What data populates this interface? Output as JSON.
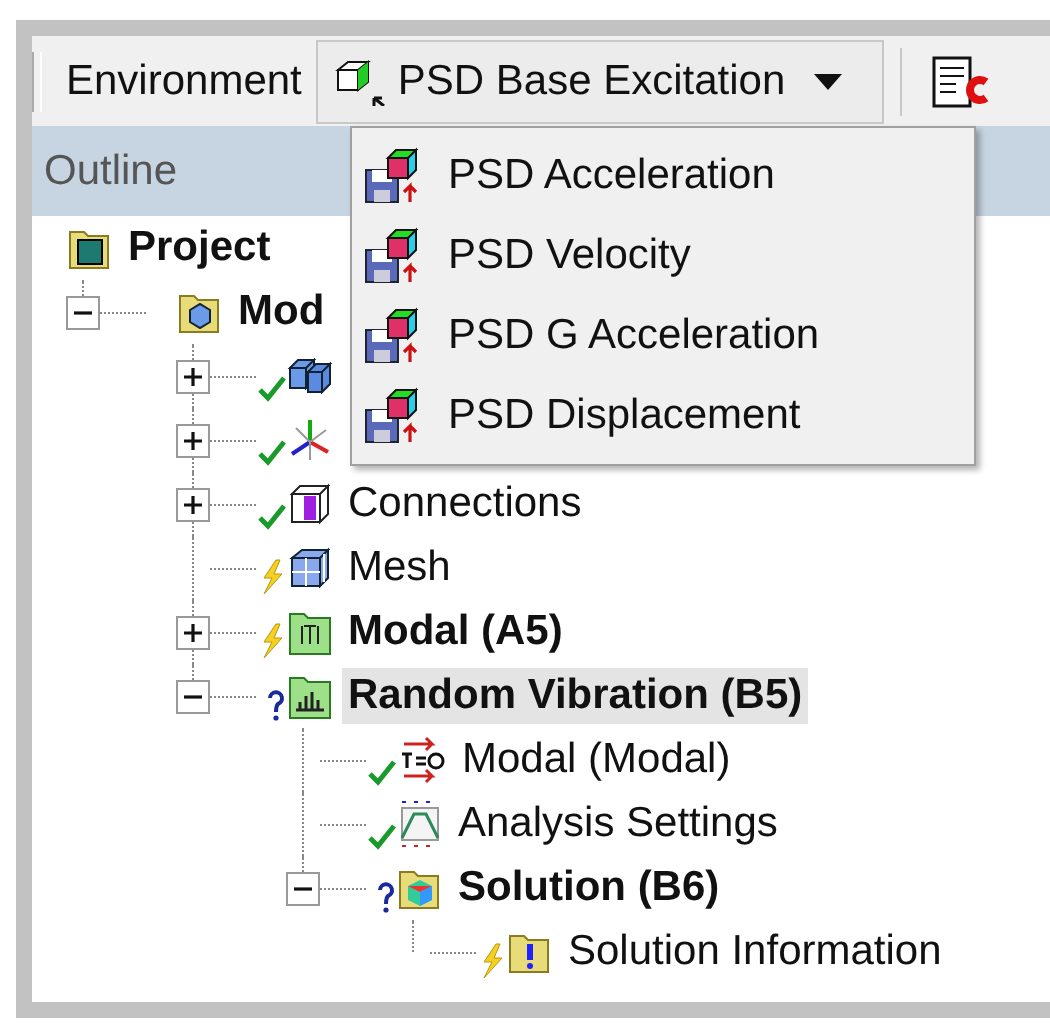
{
  "toolbar": {
    "environment_button": "Environment",
    "dropdown": {
      "label": "PSD Base Excitation",
      "open": true
    }
  },
  "outline": {
    "title": "Outline"
  },
  "menu": {
    "items": [
      {
        "label": "PSD Acceleration"
      },
      {
        "label": "PSD Velocity"
      },
      {
        "label": "PSD G Acceleration"
      },
      {
        "label": "PSD Displacement"
      }
    ]
  },
  "tree": {
    "label": "Project",
    "kind": "project",
    "bold": true,
    "selected": false,
    "children": [
      {
        "label": "Mod",
        "kind": "model",
        "bold": true,
        "selected": false,
        "expanded": true,
        "children": [
          {
            "kind": "geometry",
            "selected": false,
            "status": {
              "kind": "ok"
            },
            "expanded": false
          },
          {
            "kind": "axes",
            "selected": false,
            "status": {
              "kind": "ok"
            },
            "expanded": false
          },
          {
            "label": "Connections",
            "kind": "connections",
            "bold": false,
            "selected": false,
            "status": {
              "kind": "ok"
            },
            "expanded": false
          },
          {
            "label": "Mesh",
            "kind": "mesh",
            "bold": false,
            "selected": false,
            "status": {
              "kind": "pending"
            }
          },
          {
            "label": "Modal (A5)",
            "kind": "modal",
            "bold": true,
            "selected": false,
            "status": {
              "kind": "pending"
            },
            "expanded": false
          },
          {
            "label": "Random Vibration (B5)",
            "kind": "random",
            "bold": true,
            "selected": true,
            "status": {
              "kind": "unknown"
            },
            "expanded": true,
            "children": [
              {
                "label": "Modal (Modal)",
                "kind": "link",
                "bold": false,
                "selected": false,
                "status": {
                  "kind": "ok"
                }
              },
              {
                "label": "Analysis Settings",
                "kind": "settings",
                "bold": false,
                "selected": false,
                "status": {
                  "kind": "ok"
                }
              },
              {
                "label": "Solution (B6)",
                "kind": "solution",
                "bold": true,
                "selected": false,
                "status": {
                  "kind": "unknown"
                },
                "expanded": true,
                "children": [
                  {
                    "label": "Solution Information",
                    "kind": "info",
                    "bold": false,
                    "selected": false,
                    "status": {
                      "kind": "pending"
                    }
                  }
                ]
              }
            ]
          }
        ]
      }
    ]
  }
}
